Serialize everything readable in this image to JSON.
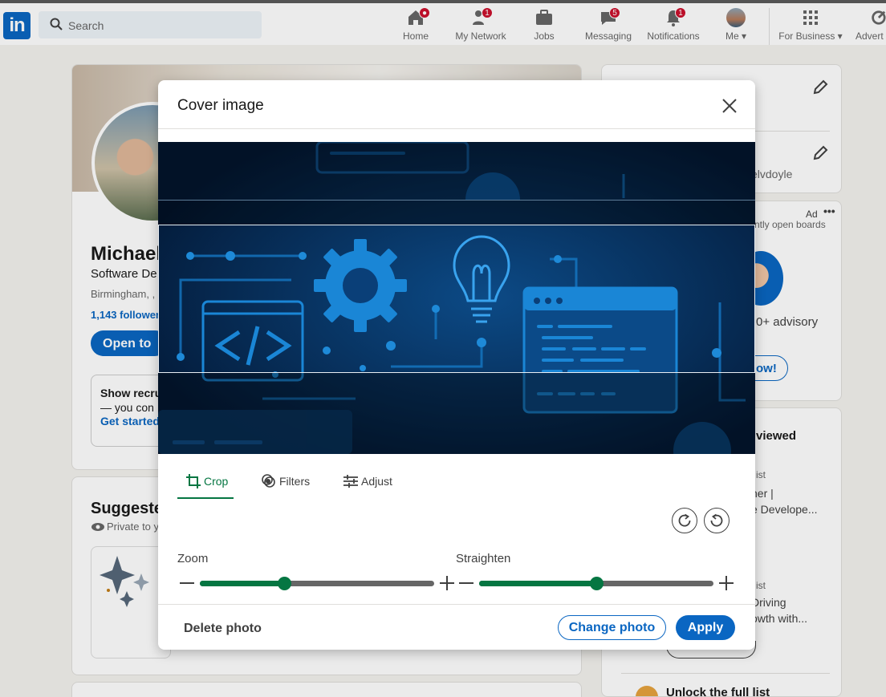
{
  "nav": {
    "logo": "in",
    "search_placeholder": "Search",
    "items": [
      {
        "label": "Home",
        "badge": ""
      },
      {
        "label": "My Network",
        "badge": "1"
      },
      {
        "label": "Jobs",
        "badge": ""
      },
      {
        "label": "Messaging",
        "badge": "5"
      },
      {
        "label": "Notifications",
        "badge": "1"
      },
      {
        "label": "Me ▾",
        "badge": ""
      },
      {
        "label": "For Business ▾",
        "badge": ""
      },
      {
        "label": "Advert",
        "badge": ""
      }
    ]
  },
  "profile": {
    "name": "Michael",
    "headline": "Software De",
    "location": "Birmingham, ,",
    "followers": "1,143 follower",
    "open_to": "Open to",
    "recruit_title": "Show recru",
    "recruit_line": "— you con",
    "recruit_link": "Get started"
  },
  "suggested": {
    "title": "Suggeste",
    "subtitle": "Private to y"
  },
  "right": {
    "url_text": "elvdoyle",
    "ad_label": "Ad",
    "ad_text": "ntly open boards",
    "ad_body": "0+ advisory",
    "ad_button": "ow!",
    "viewed_title": "viewed",
    "v1_meta": "ist",
    "v1_line1": "ner |",
    "v1_line2": "e Develope...",
    "v2_meta": "ist",
    "v2_line1": " Driving",
    "v2_line2": "owth with...",
    "unlock": "Unlock the full list"
  },
  "modal": {
    "title": "Cover image",
    "tabs": [
      "Crop",
      "Filters",
      "Adjust"
    ],
    "zoom_label": "Zoom",
    "straighten_label": "Straighten",
    "zoom_value": 0.36,
    "straighten_value": 0.5,
    "delete_label": "Delete photo",
    "change_label": "Change photo",
    "apply_label": "Apply"
  },
  "colors": {
    "brand": "#0a66c2",
    "accent": "#057642",
    "badge": "#cb112d"
  }
}
